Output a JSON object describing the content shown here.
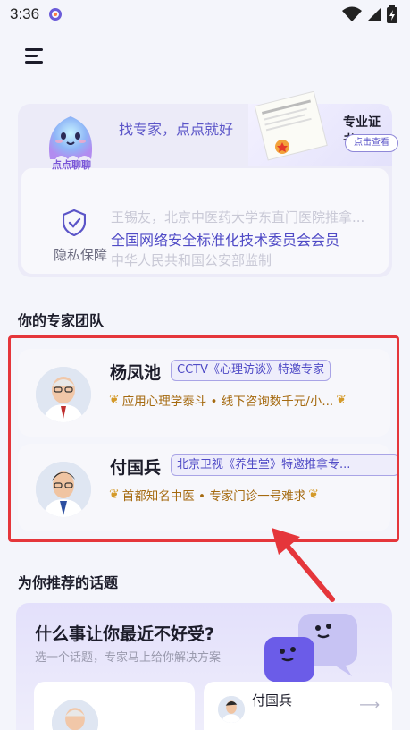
{
  "status_bar": {
    "time": "3:36"
  },
  "hero": {
    "mascot_label": "点点聊聊",
    "find_expert_text": "找专家，点点就好",
    "certificate": {
      "title": "专业证书",
      "link_label": "点击查看"
    },
    "privacy_label": "隐私保障",
    "scroll_lines": [
      "王锡友，北京中医药大学东直门医院推拿...",
      "全国网络安全标准化技术委员会会员",
      "中华人民共和国公安部监制"
    ]
  },
  "expert_section": {
    "title": "你的专家团队",
    "experts": [
      {
        "name": "杨凤池",
        "tag": "CCTV《心理访谈》特邀专家",
        "honor": "应用心理学泰斗 • 线下咨询数千元/小..."
      },
      {
        "name": "付国兵",
        "tag": "北京卫视《养生堂》特邀推拿专...",
        "honor": "首都知名中医 • 专家门诊一号难求"
      }
    ]
  },
  "topic_section": {
    "title": "为你推荐的话题",
    "card_title": "什么事让你最近不好受?",
    "card_subtitle": "选一个话题，专家马上给你解决方案",
    "mini_expert_name": "付国兵"
  },
  "colors": {
    "accent": "#4f4ac6",
    "highlight": "#e5363b",
    "gold": "#a56a10"
  }
}
